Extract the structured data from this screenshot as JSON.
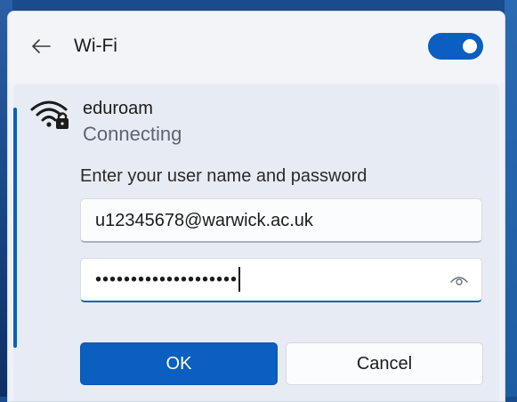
{
  "header": {
    "title": "Wi-Fi",
    "wifi_enabled": true,
    "back_icon": "arrow-left-icon"
  },
  "network": {
    "name": "eduroam",
    "status": "Connecting",
    "icon": "wifi-secured-icon"
  },
  "auth": {
    "prompt": "Enter your user name and password",
    "username": "u12345678@warwick.ac.uk",
    "password_masked": "••••••••••••••••••••",
    "reveal_icon": "eye-icon"
  },
  "buttons": {
    "ok": "OK",
    "cancel": "Cancel"
  },
  "colors": {
    "accent": "#0a5fc0",
    "panel_bg": "#e7ecf4"
  }
}
